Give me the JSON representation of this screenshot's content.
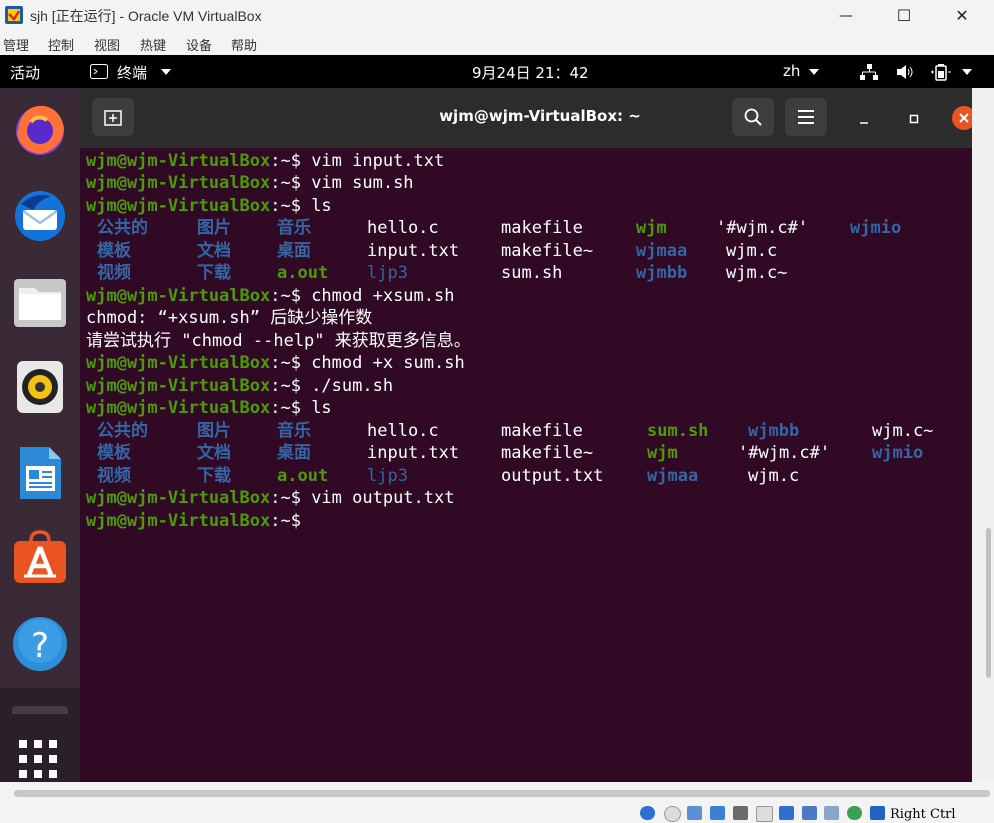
{
  "window": {
    "title": "sjh [正在运行] - Oracle VM VirtualBox",
    "minimize": "—",
    "maximize": "☐",
    "close": "✕"
  },
  "vbox_menu": [
    "管理",
    "控制",
    "视图",
    "热键",
    "设备",
    "帮助"
  ],
  "topbar": {
    "activities": "活动",
    "app": "终端",
    "datetime": "9月24日  21：42",
    "input": "zh"
  },
  "terminal": {
    "title": "wjm@wjm-VirtualBox: ~",
    "prompt": "wjm@wjm-VirtualBox",
    "path": ":~$ ",
    "commands": {
      "c1": "vim input.txt",
      "c2": "vim sum.sh",
      "c3": "ls",
      "c4": "chmod +xsum.sh",
      "c5": "chmod +x sum.sh",
      "c6": "./sum.sh",
      "c7": "ls",
      "c8": "vim output.txt"
    },
    "errors": {
      "e1": "chmod: “+xsum.sh” 后缺少操作数",
      "e2": "请尝试执行 \"chmod --help\" 来获取更多信息。"
    },
    "ls1": [
      [
        "公共的",
        "图片",
        "音乐",
        "hello.c",
        "makefile",
        "wjm",
        "'#wjm.c#'",
        "wjmio"
      ],
      [
        "模板",
        "文档",
        "桌面",
        "input.txt",
        "makefile~",
        "wjmaa",
        "wjm.c",
        ""
      ],
      [
        "视频",
        "下载",
        "a.out",
        "ljp3",
        "sum.sh",
        "wjmbb",
        "wjm.c~",
        ""
      ]
    ],
    "ls2": [
      [
        "公共的",
        "图片",
        "音乐",
        "hello.c",
        "makefile",
        "sum.sh",
        "wjmbb",
        "wjm.c~"
      ],
      [
        "模板",
        "文档",
        "桌面",
        "input.txt",
        "makefile~",
        "wjm",
        "'#wjm.c#'",
        "wjmio"
      ],
      [
        "视频",
        "下载",
        "a.out",
        "ljp3",
        "output.txt",
        "wjmaa",
        "wjm.c",
        ""
      ]
    ]
  },
  "statusbar": {
    "host_key": "Right Ctrl"
  },
  "colors": {
    "terminal_bg": "#300a24",
    "prompt_green": "#4e9a06",
    "dir_blue": "#3465a4",
    "close_orange": "#e95420"
  }
}
